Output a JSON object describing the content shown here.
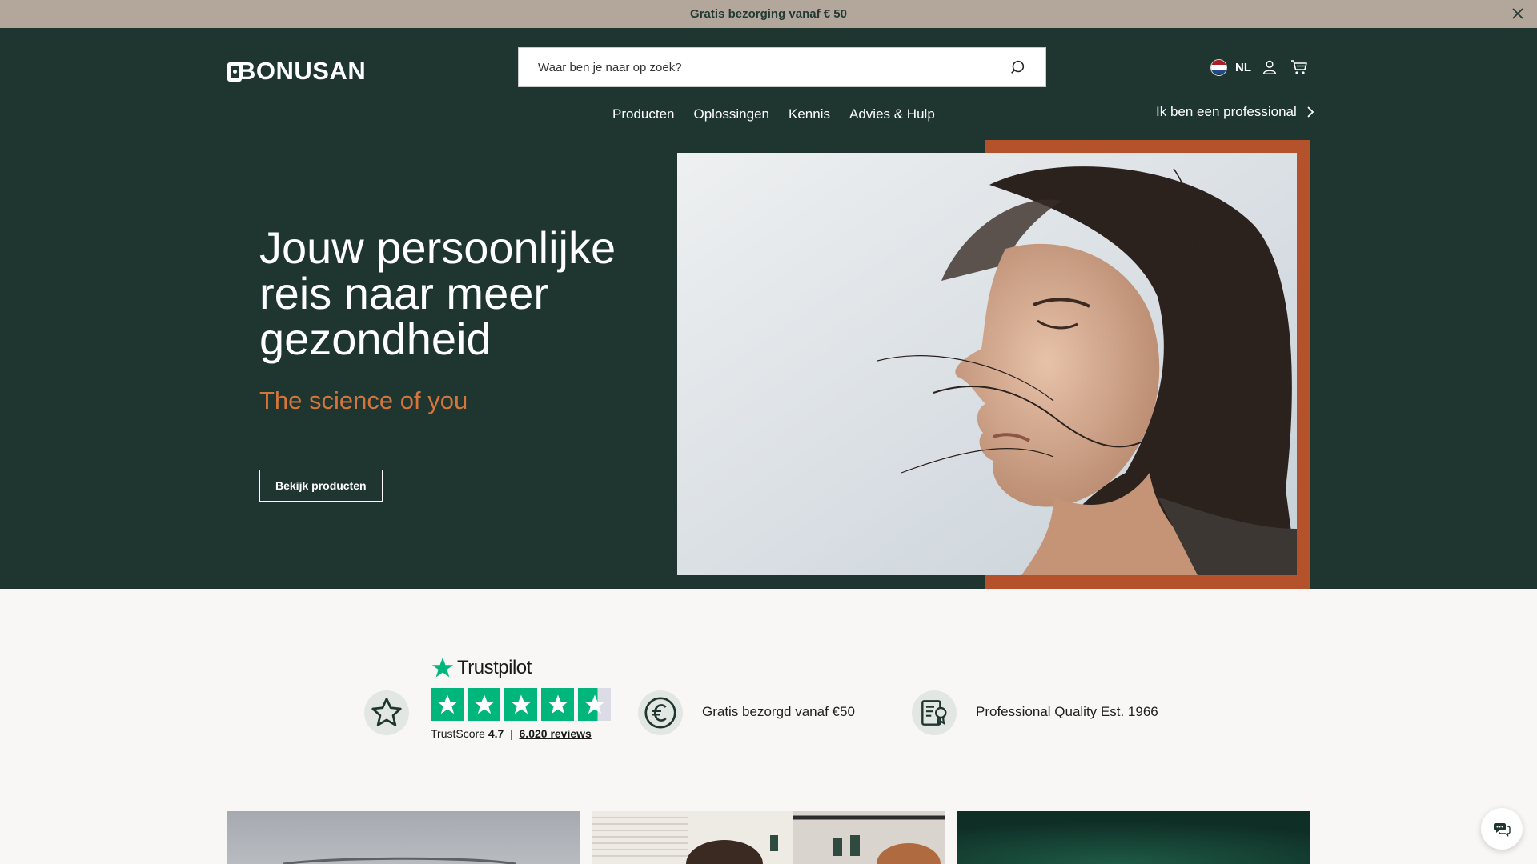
{
  "announcement": {
    "text": "Gratis bezorging vanaf € 50"
  },
  "header": {
    "logo": "BONUSAN",
    "search": {
      "placeholder": "Waar ben je naar op zoek?"
    },
    "language": "NL",
    "nav": [
      "Producten",
      "Oplossingen",
      "Kennis",
      "Advies & Hulp"
    ],
    "professional_link": "Ik ben een professional"
  },
  "hero": {
    "title": "Jouw persoonlijke reis naar meer gezondheid",
    "subtitle": "The science of you",
    "cta": "Bekijk producten"
  },
  "usps": {
    "trustpilot": {
      "brand": "Trustpilot",
      "score_label": "TrustScore",
      "score": "4.7",
      "reviews": "6.020 reviews",
      "stars": 4.7
    },
    "shipping": "Gratis bezorgd vanaf €50",
    "quality": "Professional Quality Est. 1966"
  },
  "colors": {
    "brand_green": "#1f3630",
    "accent_orange": "#b4532b",
    "subtitle_orange": "#d4763c",
    "announce_bg": "#b3a79c",
    "trustpilot_green": "#00b67a"
  }
}
